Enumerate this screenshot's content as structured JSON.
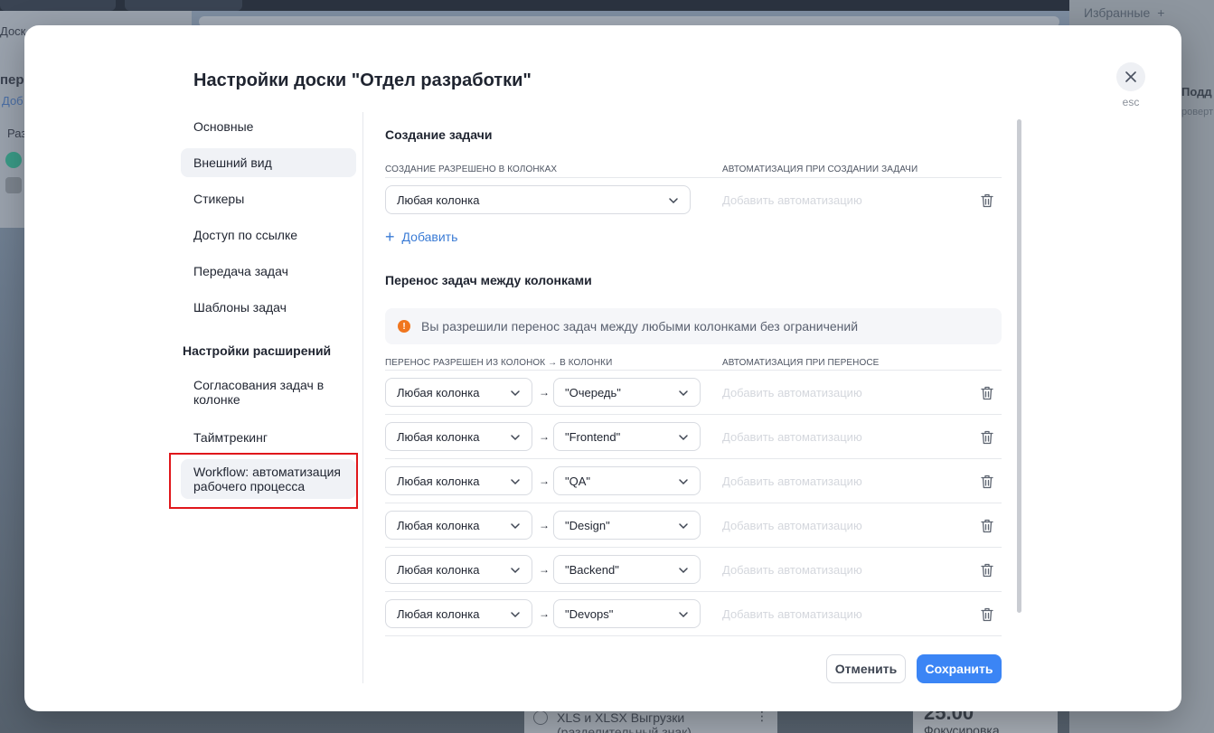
{
  "background": {
    "left_tab_text": "Доск",
    "left_text_1": "пере",
    "left_text_2": "Доб",
    "left_text_3": "Раз",
    "favorites": "Избранные",
    "favorites_plus": "+",
    "right_title": "Подд",
    "right_sub": "роверт",
    "card_line1": "XLS и XLSX Выгрузки",
    "card_line2": "(разделительный знак)",
    "card_dots": "⋮",
    "card2_value": "25.00",
    "card2_label": "Фокусировка"
  },
  "modal": {
    "title": "Настройки доски \"Отдел разработки\"",
    "close_label": "esc"
  },
  "nav": {
    "items": [
      {
        "label": "Основные"
      },
      {
        "label": "Внешний вид"
      },
      {
        "label": "Стикеры"
      },
      {
        "label": "Доступ по ссылке"
      },
      {
        "label": "Передача задач"
      },
      {
        "label": "Шаблоны задач"
      }
    ],
    "section_title": "Настройки расширений",
    "ext_items": [
      {
        "label": "Согласования задач в колонке"
      },
      {
        "label": "Таймтрекинг"
      },
      {
        "label": "Workflow: автоматизация рабочего процесса"
      }
    ]
  },
  "creation": {
    "title": "Создание задачи",
    "col_head_left": "Создание разрешено в колонках",
    "col_head_right": "Автоматизация при создании задачи",
    "select_value": "Любая колонка",
    "automation_placeholder": "Добавить автоматизацию",
    "add_label": "Добавить"
  },
  "transfer": {
    "title": "Перенос задач между колонками",
    "info_icon": "!",
    "info_text": "Вы разрешили перенос задач между любыми колонками без ограничений",
    "col_head_left": "Перенос разрешен из колонок → в колонки",
    "col_head_right": "Автоматизация при переносе",
    "arrow": "→",
    "automation_placeholder": "Добавить автоматизацию",
    "rows": [
      {
        "from": "Любая колонка",
        "to": "\"Очередь\""
      },
      {
        "from": "Любая колонка",
        "to": "\"Frontend\""
      },
      {
        "from": "Любая колонка",
        "to": "\"QA\""
      },
      {
        "from": "Любая колонка",
        "to": "\"Design\""
      },
      {
        "from": "Любая колонка",
        "to": "\"Backend\""
      },
      {
        "from": "Любая колонка",
        "to": "\"Devops\""
      }
    ]
  },
  "footer": {
    "cancel": "Отменить",
    "save": "Сохранить"
  },
  "colors": {
    "accent": "#3b85f5",
    "link": "#3a7bd5",
    "warning": "#f0761f",
    "highlight": "#e0171b"
  }
}
